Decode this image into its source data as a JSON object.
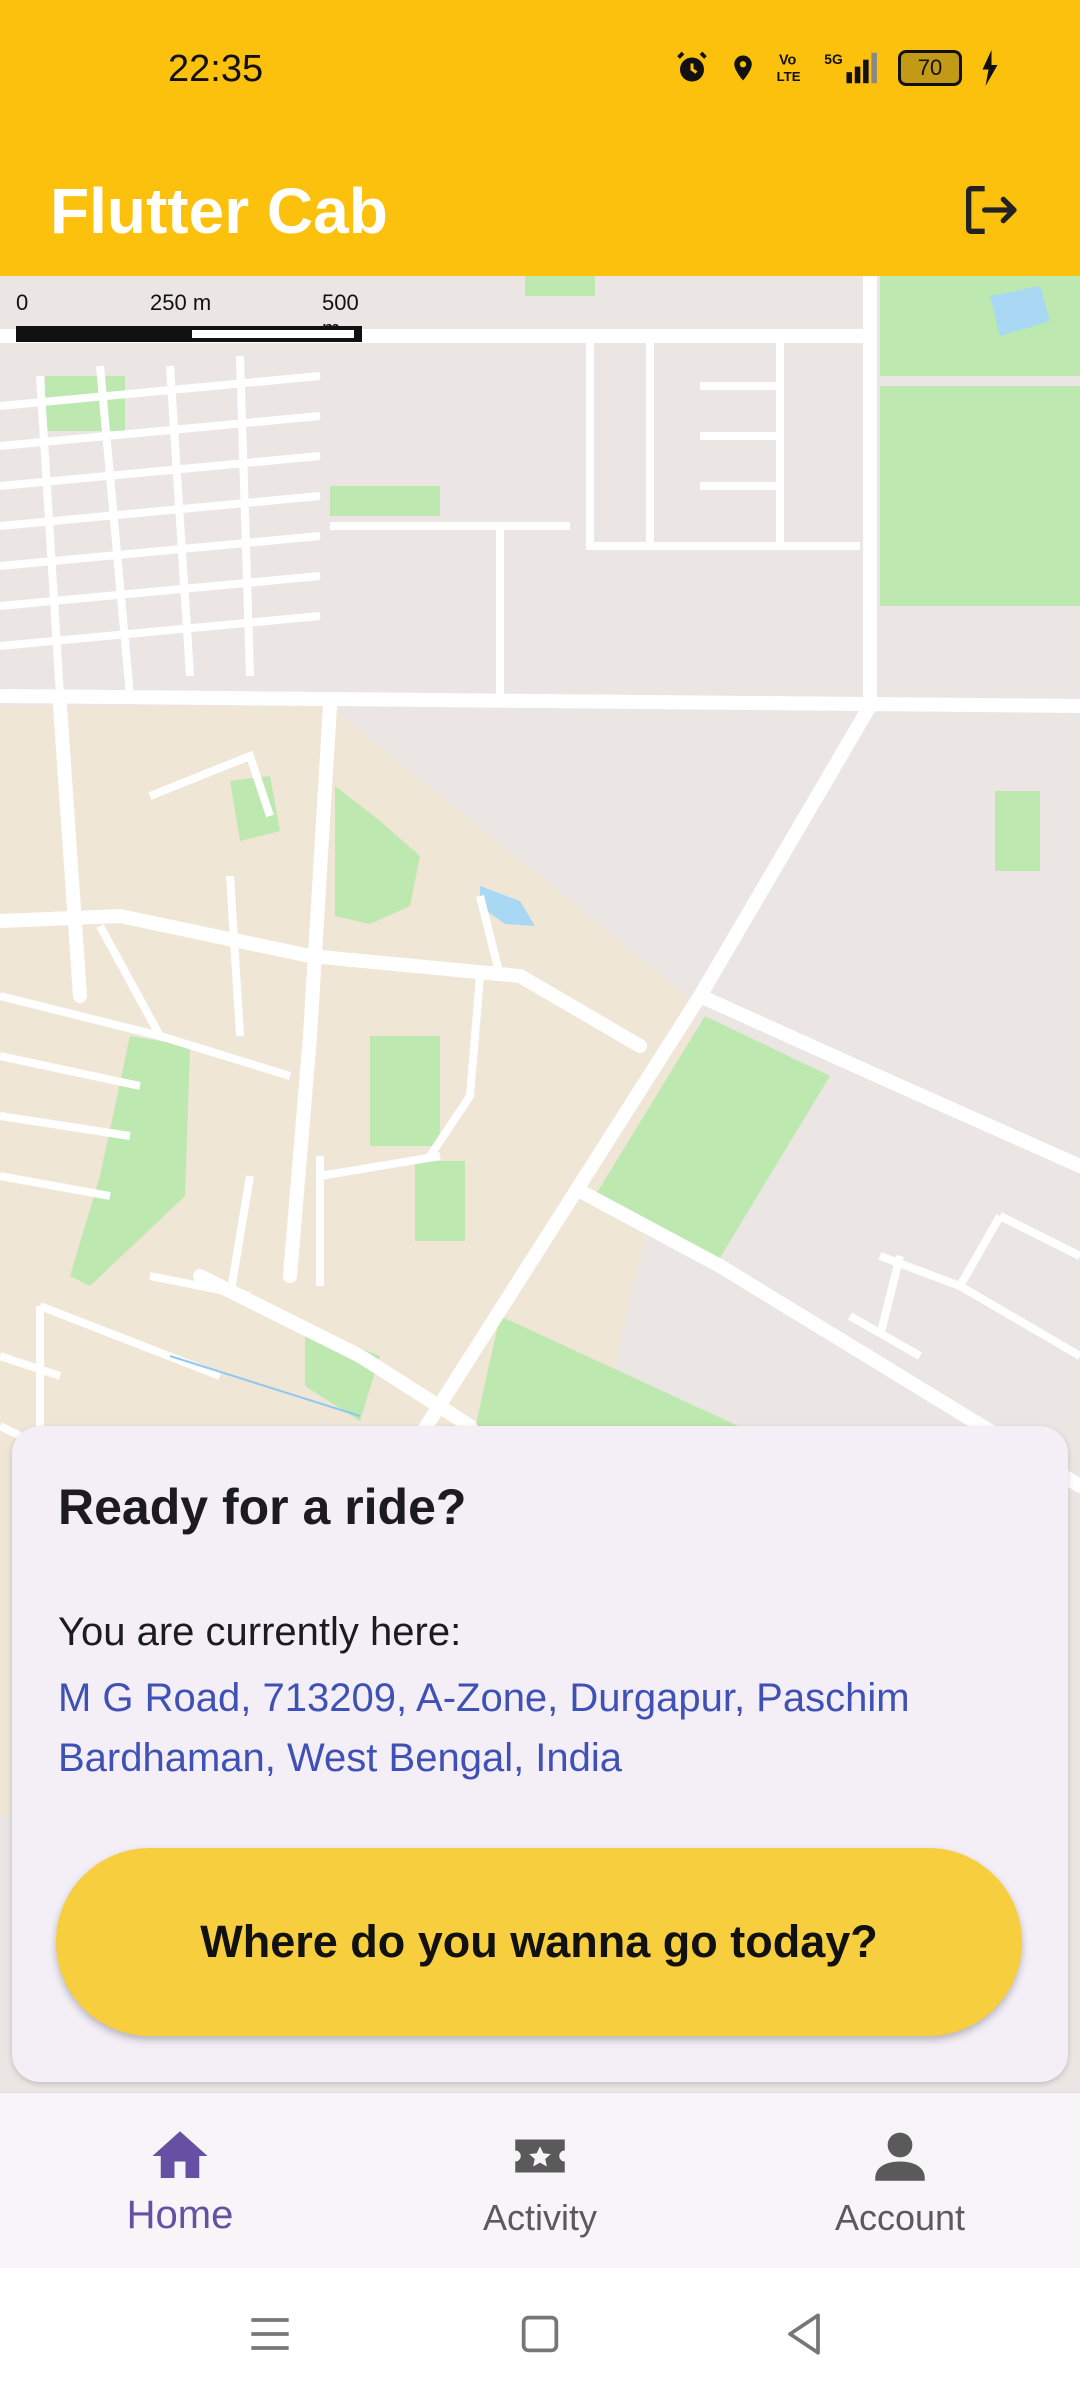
{
  "status_bar": {
    "time": "22:35",
    "battery": "70",
    "icons": [
      "alarm-icon",
      "location-icon",
      "volte-icon",
      "5g-signal-icon",
      "battery-icon",
      "charging-icon"
    ]
  },
  "app_bar": {
    "title": "Flutter Cab",
    "action_icon": "logout-icon"
  },
  "map": {
    "scale_labels": [
      "0",
      "250 m",
      "500 m"
    ]
  },
  "card": {
    "heading": "Ready for a ride?",
    "location_label": "You are currently here:",
    "address": "M G Road, 713209, A-Zone, Durgapur, Paschim Bardhaman, West Bengal, India",
    "cta_label": "Where do you wanna go today?"
  },
  "bottom_nav": {
    "items": [
      {
        "label": "Home",
        "icon": "home-icon",
        "active": true
      },
      {
        "label": "Activity",
        "icon": "activity-icon",
        "active": false
      },
      {
        "label": "Account",
        "icon": "account-icon",
        "active": false
      }
    ]
  },
  "colors": {
    "app_bar": "#fcc10d",
    "cta": "#f7cf3e",
    "address_text": "#3f51b5",
    "nav_active": "#6650a4",
    "location_dot": "#4d8ae2"
  }
}
